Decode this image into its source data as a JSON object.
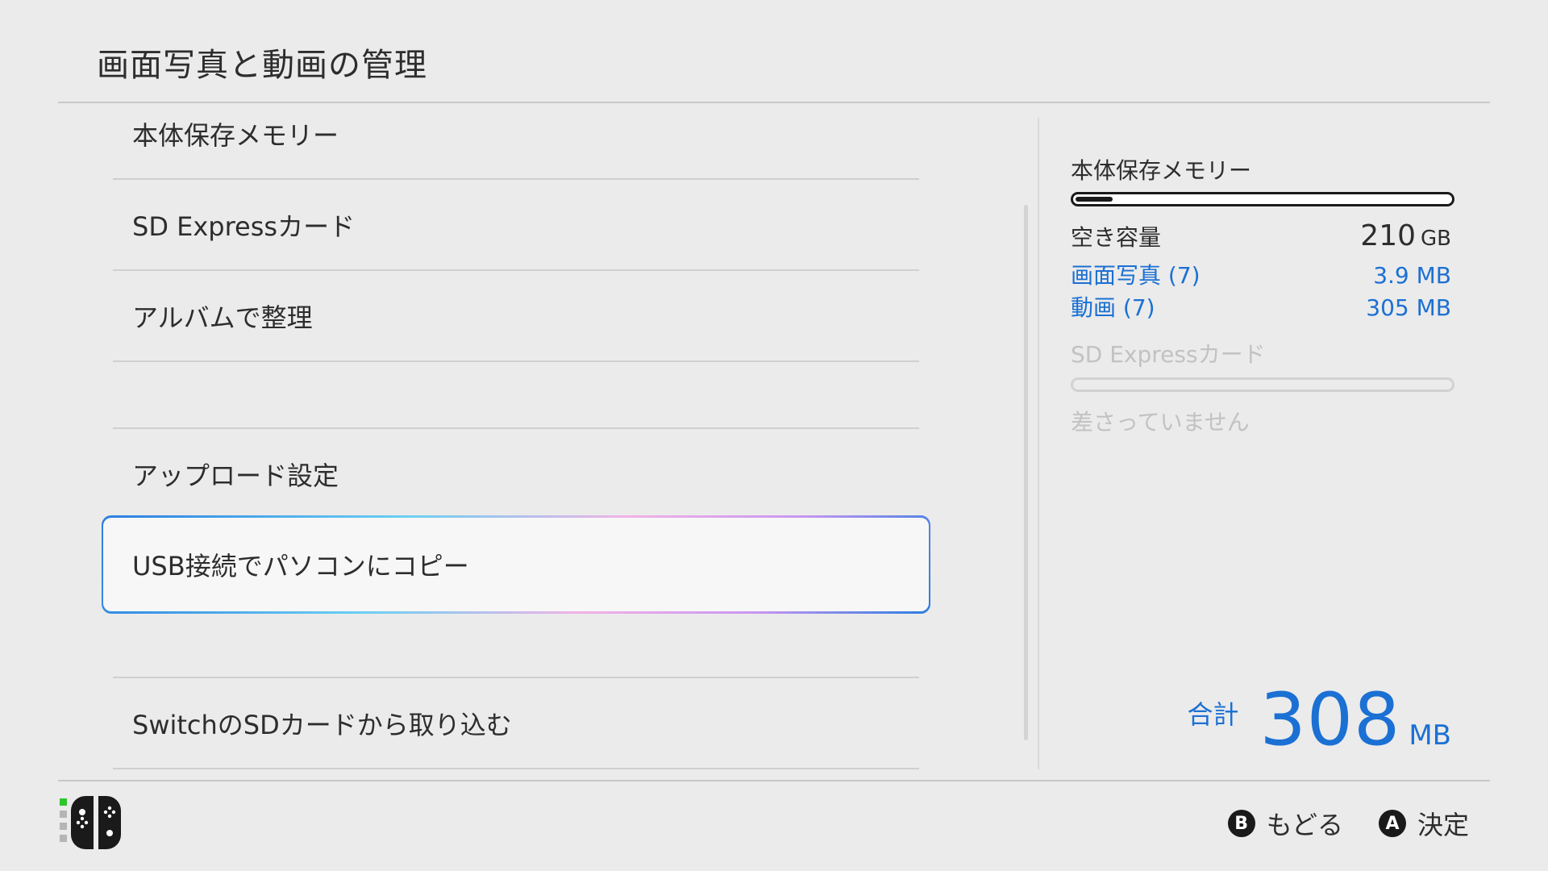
{
  "header": {
    "title": "画面写真と動画の管理"
  },
  "menu": {
    "items": [
      {
        "label": "本体保存メモリー"
      },
      {
        "label": "SD Expressカード"
      },
      {
        "label": "アルバムで整理"
      },
      {
        "label": "アップロード設定"
      },
      {
        "label": "USB接続でパソコンにコピー",
        "selected": true
      },
      {
        "label": "SwitchのSDカードから取り込む"
      }
    ]
  },
  "storage": {
    "internal": {
      "label": "本体保存メモリー",
      "used_fraction": 0.1,
      "free_label": "空き容量",
      "free_value": "210",
      "free_unit": "GB",
      "screenshots_label": "画面写真 (7)",
      "screenshots_size": "3.9 MB",
      "videos_label": "動画 (7)",
      "videos_size": "305 MB"
    },
    "sd": {
      "label": "SD Expressカード",
      "status": "差さっていません"
    },
    "total": {
      "label": "合計",
      "value": "308",
      "unit": "MB"
    }
  },
  "footer": {
    "back": {
      "button": "B",
      "label": "もどる"
    },
    "confirm": {
      "button": "A",
      "label": "決定"
    },
    "controller_icon": "joycon-pair-icon"
  },
  "colors": {
    "accent": "#1b70d3",
    "background": "#ebebeb",
    "text": "#2d2d2d",
    "disabled": "#c2c2c2"
  }
}
